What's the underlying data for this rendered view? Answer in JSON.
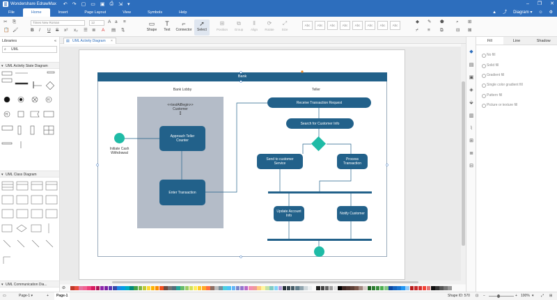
{
  "app": {
    "title": "Wondershare EdrawMax",
    "window_controls": [
      "–",
      "❐",
      "✕"
    ]
  },
  "menu": {
    "items": [
      "File",
      "Home",
      "Insert",
      "Page Layout",
      "View",
      "Symbols",
      "Help"
    ],
    "active": "Home",
    "diagram_label": "Diagram"
  },
  "ribbon": {
    "font_name": "Times New Roman",
    "font_size": "12",
    "tools": [
      "Shape",
      "Text",
      "Connector",
      "Select"
    ],
    "selected_tool": "Select",
    "disabled_tools": [
      "Position",
      "Group",
      "Align",
      "Rotate",
      "Size"
    ],
    "style_boxes": [
      "Abc",
      "Abc",
      "Abc",
      "Abc",
      "Abc",
      "Abc",
      "Abc",
      "Abc",
      "Abc"
    ]
  },
  "left_panel": {
    "title": "Libraries",
    "search_value": "UML",
    "categories": [
      "UML Activity State Diagram",
      "UML Class Diagram",
      "UML Communication Dia..."
    ]
  },
  "doc_tab": {
    "label": "UML Activity Diagram"
  },
  "diagram": {
    "swimlane_title": "Bank",
    "lane_left": "Bank Lobby",
    "lane_right": "Teller",
    "customer_label": "<<testAtBegin>>\nCustomer\n[]",
    "initial_label": "Initiate Cash\nWithdrawal",
    "activities": {
      "approach": "Approach Teller\nCounter",
      "enter": "Enter Transaction",
      "receive": "Receive Transaction Request",
      "search": "Search for Customer Info",
      "send": "Send to customer\nService",
      "process": "Process\nTransaction",
      "update": "Update Account\nInfo",
      "notify": "Notify Customer"
    }
  },
  "right_panel": {
    "tabs": [
      "Fill",
      "Line",
      "Shadow"
    ],
    "active_tab": "Fill",
    "fill_options": [
      "No fill",
      "Solid fill",
      "Gradient fill",
      "Single color gradient fill",
      "Pattern fill",
      "Picture or texture fill"
    ]
  },
  "status": {
    "page_select": "Page-1",
    "page_tab": "Page-1",
    "shape_id": "Shape ID: 570",
    "zoom": "100%"
  },
  "colors": {
    "brand": "#2d6ebd",
    "activity": "#22618a",
    "accent": "#1fbba6",
    "lane": "#b4bcc8"
  }
}
